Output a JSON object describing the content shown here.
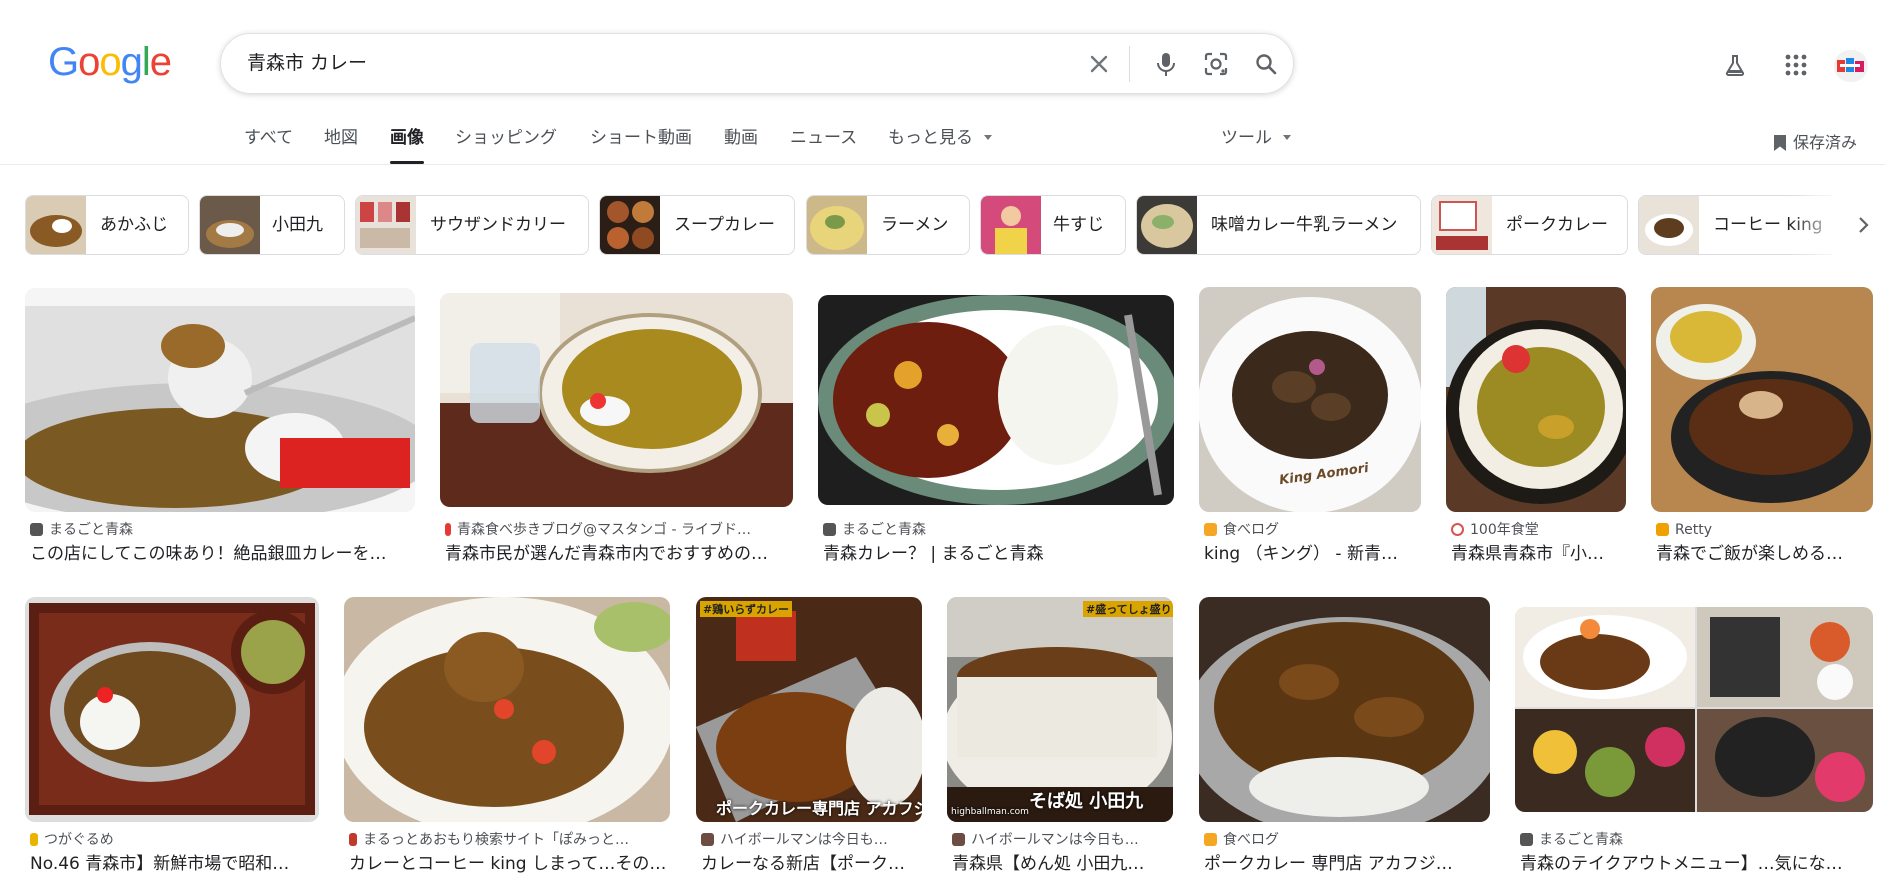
{
  "header": {
    "logo_text": "Google",
    "logo_colors": [
      "#4285F4",
      "#EA4335",
      "#FBBC05",
      "#4285F4",
      "#34A853",
      "#EA4335"
    ],
    "query": "青森市 カレー",
    "icons": {
      "clear": "close-icon",
      "voice": "microphone-icon",
      "lens": "camera-icon",
      "search": "search-icon",
      "labs": "flask-icon",
      "apps": "apps-grid-icon",
      "account": "avatar"
    }
  },
  "tabs": [
    {
      "label": "すべて"
    },
    {
      "label": "地図"
    },
    {
      "label": "画像",
      "active": true
    },
    {
      "label": "ショッピング"
    },
    {
      "label": "ショート動画"
    },
    {
      "label": "動画"
    },
    {
      "label": "ニュース"
    },
    {
      "label": "もっと見る"
    }
  ],
  "tools_label": "ツール",
  "saved_label": "保存済み",
  "chips": [
    {
      "label": "あかふじ"
    },
    {
      "label": "小田九"
    },
    {
      "label": "サウザンドカリー"
    },
    {
      "label": "スープカレー"
    },
    {
      "label": "ラーメン"
    },
    {
      "label": "牛すじ"
    },
    {
      "label": "味噌カレー牛乳ラーメン"
    },
    {
      "label": "ポークカレー"
    },
    {
      "label": "コーヒー king"
    }
  ],
  "results_row1": [
    {
      "source": "まるごと青森",
      "title": "この店にしてこの味あり！絶品銀皿カレーを…",
      "fav_color": "#555555"
    },
    {
      "source": "青森食べ歩きブログ@マスタンゴ - ライブド…",
      "title": "青森市民が選んだ青森市内でおすすめの…",
      "fav_color": "#e53935"
    },
    {
      "source": "まるごと青森",
      "title": "青森カレー？ | まるごと青森",
      "fav_color": "#555555"
    },
    {
      "source": "食べログ",
      "title": "king （キング） - 新青…",
      "fav_color": "#f5a623",
      "overlay": "King Aomori"
    },
    {
      "source": "100年食堂",
      "title": "青森県青森市『小…",
      "fav_color": "#d9534f"
    },
    {
      "source": "Retty",
      "title": "青森でご飯が楽しめる…",
      "fav_color": "#f0a000"
    }
  ],
  "results_row2": [
    {
      "source": "つがぐるめ",
      "title": "No.46 青森市】新鮮市場で昭和…",
      "fav_color": "#e8b400"
    },
    {
      "source": "まるっとあおもり検索サイト「ぽみっと…",
      "title": "カレーとコーヒー king しまって…その…",
      "fav_color": "#c0392b"
    },
    {
      "source": "ハイボールマンは今日も…",
      "title": "カレーなる新店【ポーク…",
      "fav_color": "#6d4c41",
      "overlay_top": "#鶏いらずカレー",
      "overlay": "ポークカレー専門店 アカフジ"
    },
    {
      "source": "ハイボールマンは今日も…",
      "title": "青森県【めん処 小田九…",
      "fav_color": "#6d4c41",
      "overlay_top": "#盛ってしょ盛り",
      "overlay": "そば処 小田九",
      "overlay_small": "highballman.com"
    },
    {
      "source": "食べログ",
      "title": "ポークカレー 専門店 アカフジ…",
      "fav_color": "#f5a623"
    },
    {
      "source": "まるごと青森",
      "title": "青森のテイクアウトメニュー】…気にな…",
      "fav_color": "#555555"
    }
  ]
}
